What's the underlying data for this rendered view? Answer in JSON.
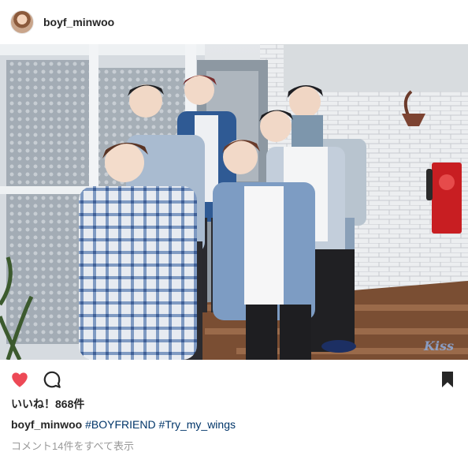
{
  "header": {
    "username": "boyf_minwoo"
  },
  "photo": {
    "watermark": "Kiss"
  },
  "actions": {
    "like_icon": "heart-icon",
    "comment_icon": "comment-icon",
    "save_icon": "bookmark-icon",
    "like_color": "#ed4956"
  },
  "likes": {
    "text": "いいね！868件"
  },
  "caption": {
    "username": "boyf_minwoo",
    "tags": [
      "#BOYFRIEND",
      "#Try_my_wings"
    ]
  },
  "comments": {
    "view_all": "コメント14件をすべて表示"
  }
}
